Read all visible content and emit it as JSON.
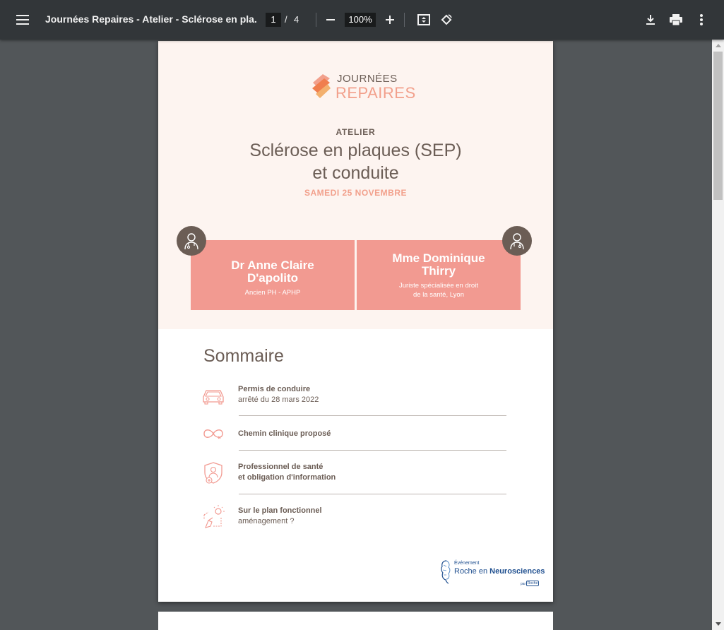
{
  "toolbar": {
    "title": "Journées Repaires - Atelier - Sclérose en pla...",
    "page_current": "1",
    "page_separator": "/",
    "page_total": "4",
    "zoom": "100%"
  },
  "page": {
    "logo": {
      "line1": "JOURNÉES",
      "line2": "REPAIRES"
    },
    "kicker": "ATELIER",
    "title_line1": "Sclérose en plaques (SEP)",
    "title_line2": "et conduite",
    "date": "SAMEDI 25 NOVEMBRE",
    "speakers": [
      {
        "name_line1": "Dr Anne Claire",
        "name_line2": "D'apolito",
        "role_line1": "Ancien PH - APHP",
        "role_line2": ""
      },
      {
        "name_line1": "Mme Dominique",
        "name_line2": "Thirry",
        "role_line1": "Juriste spécialisée en droit",
        "role_line2": "de la santé, Lyon"
      }
    ],
    "sommaire_title": "Sommaire",
    "items": [
      {
        "icon": "car-icon",
        "title": "Permis de conduire",
        "subtitle": "arrêté du 28 mars 2022"
      },
      {
        "icon": "infinity-icon",
        "title": "Chemin clinique proposé",
        "subtitle": ""
      },
      {
        "icon": "doctor-shield-icon",
        "title": "Professionnel de santé",
        "subtitle": "et obligation d'information"
      },
      {
        "icon": "idea-hand-icon",
        "title": "Sur le plan fonctionnel",
        "subtitle": "aménagement ?"
      }
    ],
    "footer": {
      "small": "Événement",
      "main_prefix": "Roche en ",
      "main_bold": "Neurosciences",
      "par": "par",
      "roche": "Roche"
    }
  },
  "colors": {
    "toolbar_bg": "#323639",
    "viewer_bg": "#525659",
    "accent_salmon": "#f29a91",
    "brown_text": "#6b5d55",
    "hero_bg": "#fdf4f0"
  }
}
